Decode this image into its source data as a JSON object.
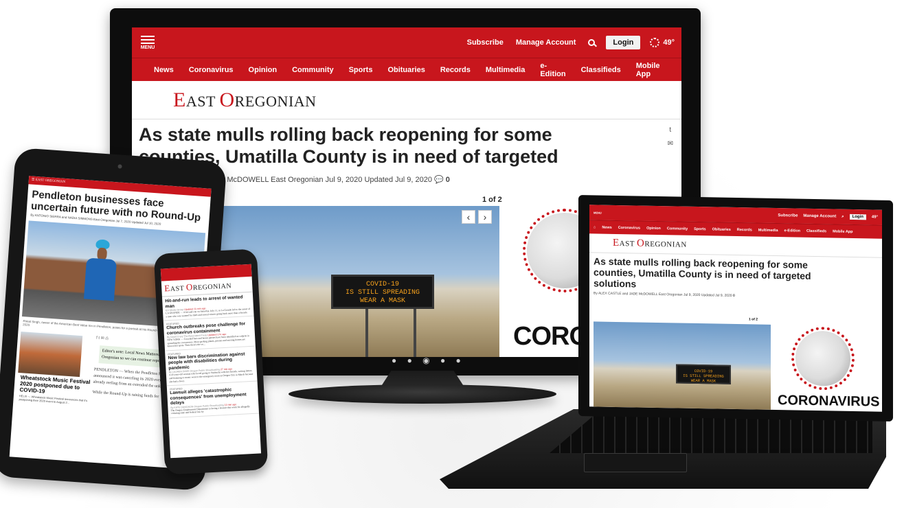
{
  "colors": {
    "brand_red": "#c8161d",
    "dark_red": "#a40f15",
    "device_black": "#0d0d0d"
  },
  "site": {
    "logo_first_cap": "E",
    "logo_first_rest": "AST ",
    "logo_second_cap": "O",
    "logo_second_rest": "REGONIAN"
  },
  "monitor": {
    "menu_label": "MENU",
    "top_links": [
      "Subscribe",
      "Manage Account"
    ],
    "login_label": "Login",
    "temperature": "49°",
    "nav": [
      "News",
      "Coronavirus",
      "Opinion",
      "Community",
      "Sports",
      "Obituaries",
      "Records",
      "Multimedia",
      "e-Edition",
      "Classifieds",
      "Mobile App"
    ],
    "headline": "As state mulls rolling back reopening for some counties, Umatilla County is in need of targeted solutions",
    "byline": "DE McDOWELL East Oregonian   Jul 9, 2020 Updated Jul 9, 2020",
    "comment_count": "0",
    "gallery_count": "1 of 2",
    "sign_lines": [
      "COVID-19",
      "IS STILL SPREADING",
      "WEAR A MASK"
    ],
    "promo_text": "CORO"
  },
  "laptop": {
    "menu_label": "MENU",
    "top_links": [
      "Subscribe",
      "Manage Account"
    ],
    "login_label": "Login",
    "temperature": "49°",
    "nav": [
      "News",
      "Coronavirus",
      "Opinion",
      "Community",
      "Sports",
      "Obituaries",
      "Records",
      "Multimedia",
      "e-Edition",
      "Classifieds",
      "Mobile App"
    ],
    "headline": "As state mulls rolling back reopening for some counties, Umatilla County is in need of targeted solutions",
    "byline": "By ALEX CASTLE and JADE McDOWELL East Oregonian   Jul 9, 2020 Updated Jul 9, 2020",
    "comment_count": "0",
    "gallery_count": "1 of 2",
    "sign_lines": [
      "COVID-19",
      "IS STILL SPREADING",
      "WEAR A MASK"
    ],
    "promo_text": "CORONAVIRUS"
  },
  "tablet": {
    "headline": "Pendleton businesses face uncertain future with no Round-Up",
    "byline": "By ANTONIO SIERRA and NADIA SIMMONS East Oregonian   Jul 7, 2020 Updated Jul 10, 2020",
    "caption": "Rimal Singh, owner of the American Best Value Inn in Pendleton, poses for a portrait at his Round-Up hotel on Monday, July 6, 2020.",
    "editors_note": "Editor's note: Local News Matters. Please support East Oregonian so we can continue reporting. Thank you.",
    "side_headline": "Wheatstock Music Festival 2020 postponed due to COVID-19",
    "side_body": "HELIX — Wheatstock Music Festival announces that it's postponing their 2020 event to August 2...",
    "body_1": "PENDLETON — When the Pendleton Round-Up announced it was canceling its 2020 event, the community already reeling from an extended the unknown.",
    "body_2": "While the Round-Up is raising funds for"
  },
  "phone": {
    "items": [
      {
        "tag": "",
        "headline": "Hit-and-run leads to arrest of wanted man",
        "meta": "EO Media Group",
        "updated": "Updated 11 min ago",
        "body": "LA GRANDE — A hit-and-run on Saturday, July 11, in La Grande led to the arrest of a man who was wanted for theft and sexual crimes going back more than a decade."
      },
      {
        "tag": "Featured",
        "headline": "Church outbreaks pose challenge for coronavirus containment",
        "meta": "By David Crary The Associated Press",
        "updated": "Updated 1 hr ago",
        "body": "NEW YORK — Crowded bars and house parties have been identified as culprits in spreading the coronavirus. Most packing plants, prisons and nursing homes are known hot spots. Then there's the co..."
      },
      {
        "tag": "Featured",
        "headline": "New law bars discrimination against people with disabilities during pandemic",
        "meta": "By LAUREN DAKE Oregon Public Broadcasting",
        "updated": "27 min ago",
        "body": "A 43-year-old woman who loved going to Starbucks with her friends, writing letters and listening to music went to the emergency room in Oregon City in March because she had a fever."
      },
      {
        "tag": "Featured",
        "headline": "Lawsuit alleges 'catastrophic consequences' from unemployment delays",
        "meta": "By KATE DAVIDSON Oregon Public Broadcasting",
        "updated": "13 min ago",
        "body": "The Oregon Employment Department is facing a lawsuit this week for allegedly violating state and federal law by"
      }
    ]
  }
}
